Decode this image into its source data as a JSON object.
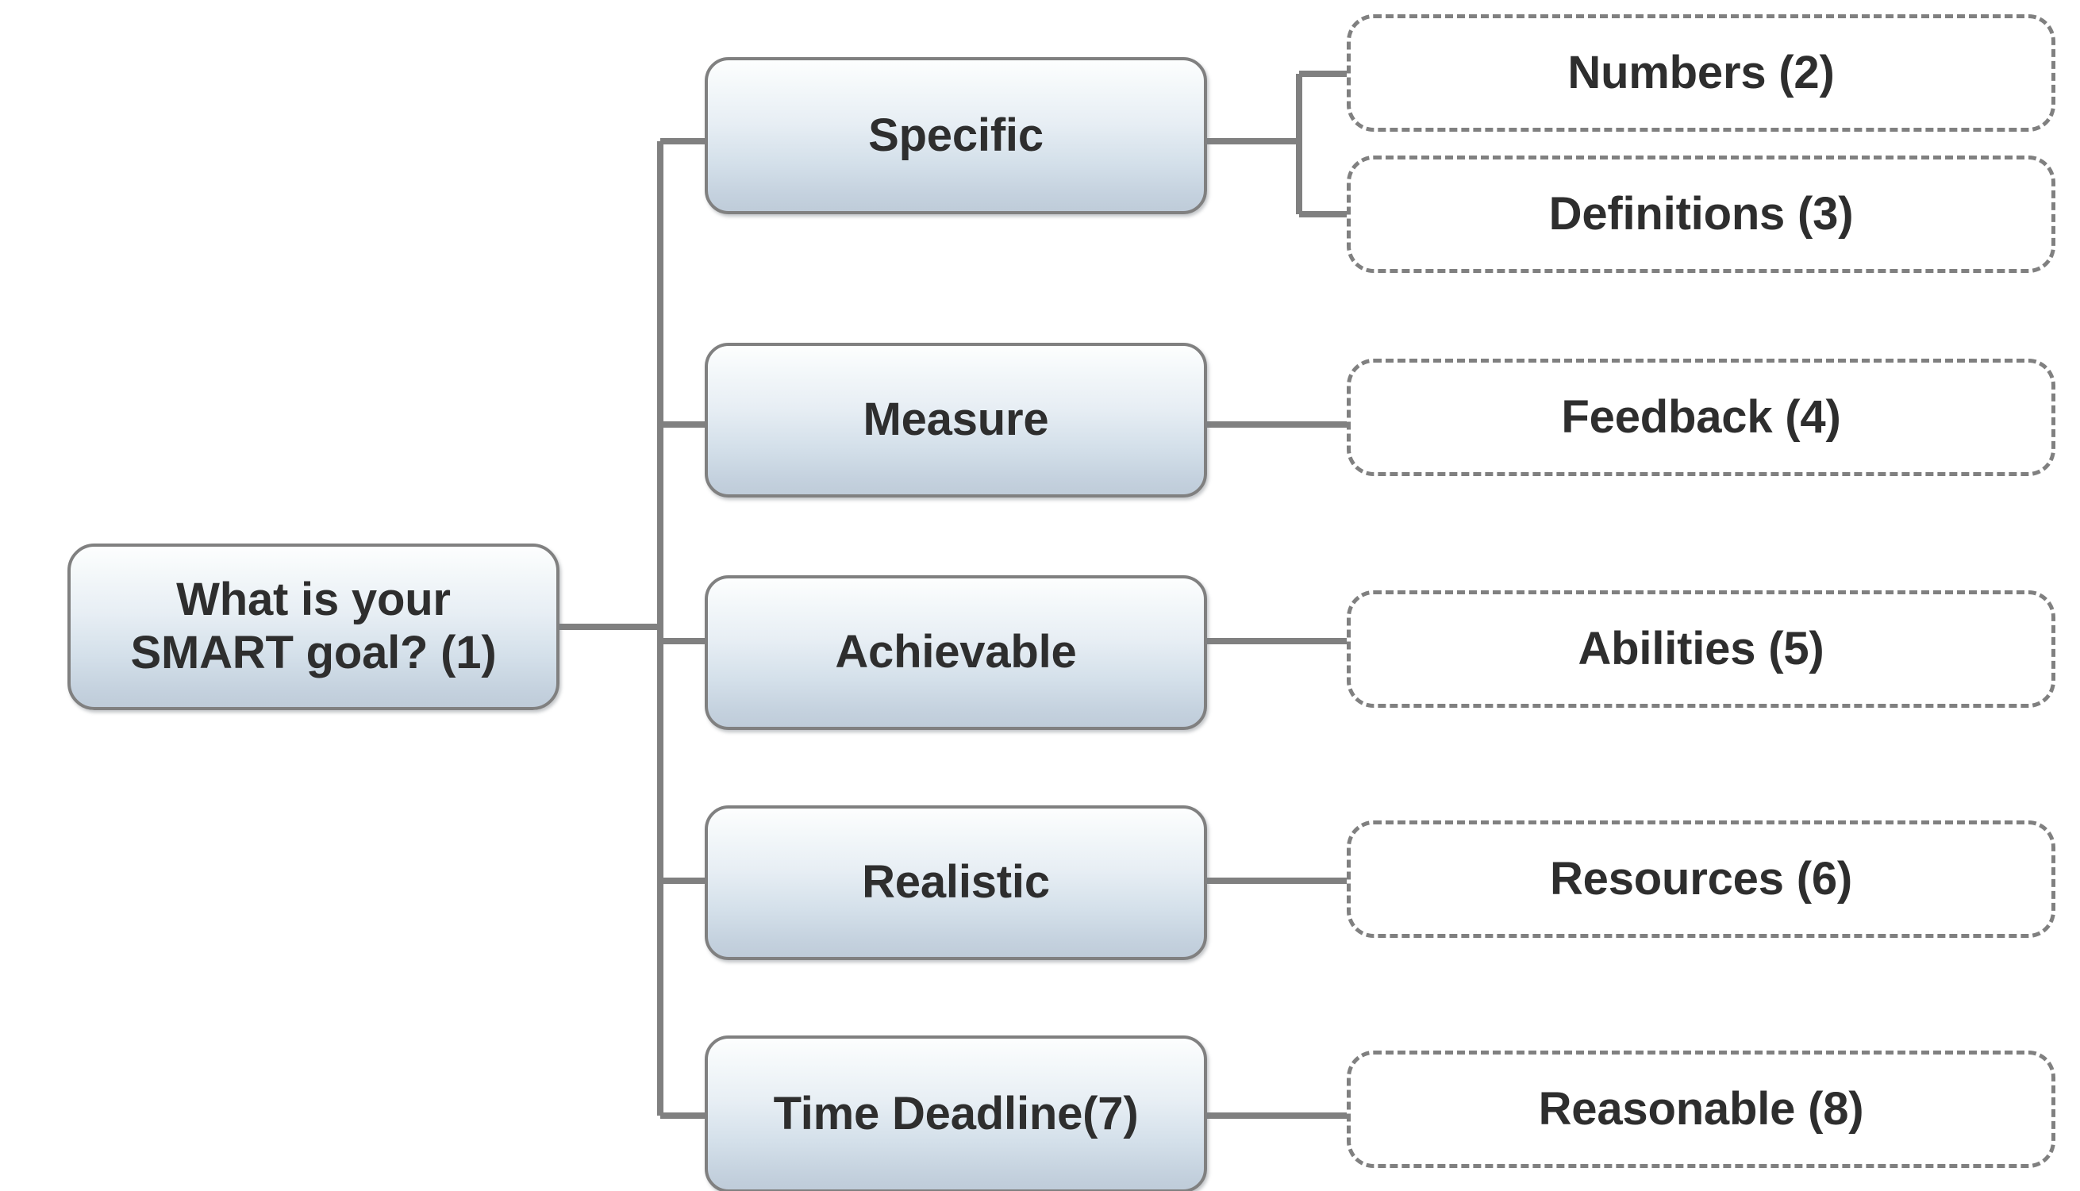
{
  "diagram": {
    "title": "SMART goal breakdown tree",
    "colors": {
      "connector": "#808080",
      "node_border": "#808080",
      "node_gradient_top": "#fdfefe",
      "node_gradient_bottom": "#bfccd9",
      "dashed_border": "#808080",
      "dashed_fill": "#ffffff",
      "text": "#2e2e2e"
    },
    "root": {
      "id": "root",
      "label": "What is your\nSMART goal? (1)",
      "number": "1",
      "style": "solid-gradient-rounded"
    },
    "branches": [
      {
        "id": "specific",
        "label": "Specific",
        "style": "solid-gradient-rounded"
      },
      {
        "id": "measure",
        "label": "Measure",
        "style": "solid-gradient-rounded"
      },
      {
        "id": "achievable",
        "label": "Achievable",
        "style": "solid-gradient-rounded"
      },
      {
        "id": "realistic",
        "label": "Realistic",
        "style": "solid-gradient-rounded"
      },
      {
        "id": "time",
        "label": "Time Deadline(7)",
        "number": "7",
        "style": "solid-gradient-rounded"
      }
    ],
    "leaves": [
      {
        "id": "numbers",
        "label": "Numbers (2)",
        "number": "2",
        "parent": "specific",
        "style": "dashed-rounded"
      },
      {
        "id": "definitions",
        "label": "Definitions (3)",
        "number": "3",
        "parent": "specific",
        "style": "dashed-rounded"
      },
      {
        "id": "feedback",
        "label": "Feedback (4)",
        "number": "4",
        "parent": "measure",
        "style": "dashed-rounded"
      },
      {
        "id": "abilities",
        "label": "Abilities (5)",
        "number": "5",
        "parent": "achievable",
        "style": "dashed-rounded"
      },
      {
        "id": "resources",
        "label": "Resources (6)",
        "number": "6",
        "parent": "realistic",
        "style": "dashed-rounded"
      },
      {
        "id": "reasonable",
        "label": "Reasonable (8)",
        "number": "8",
        "parent": "time",
        "style": "dashed-rounded"
      }
    ]
  }
}
